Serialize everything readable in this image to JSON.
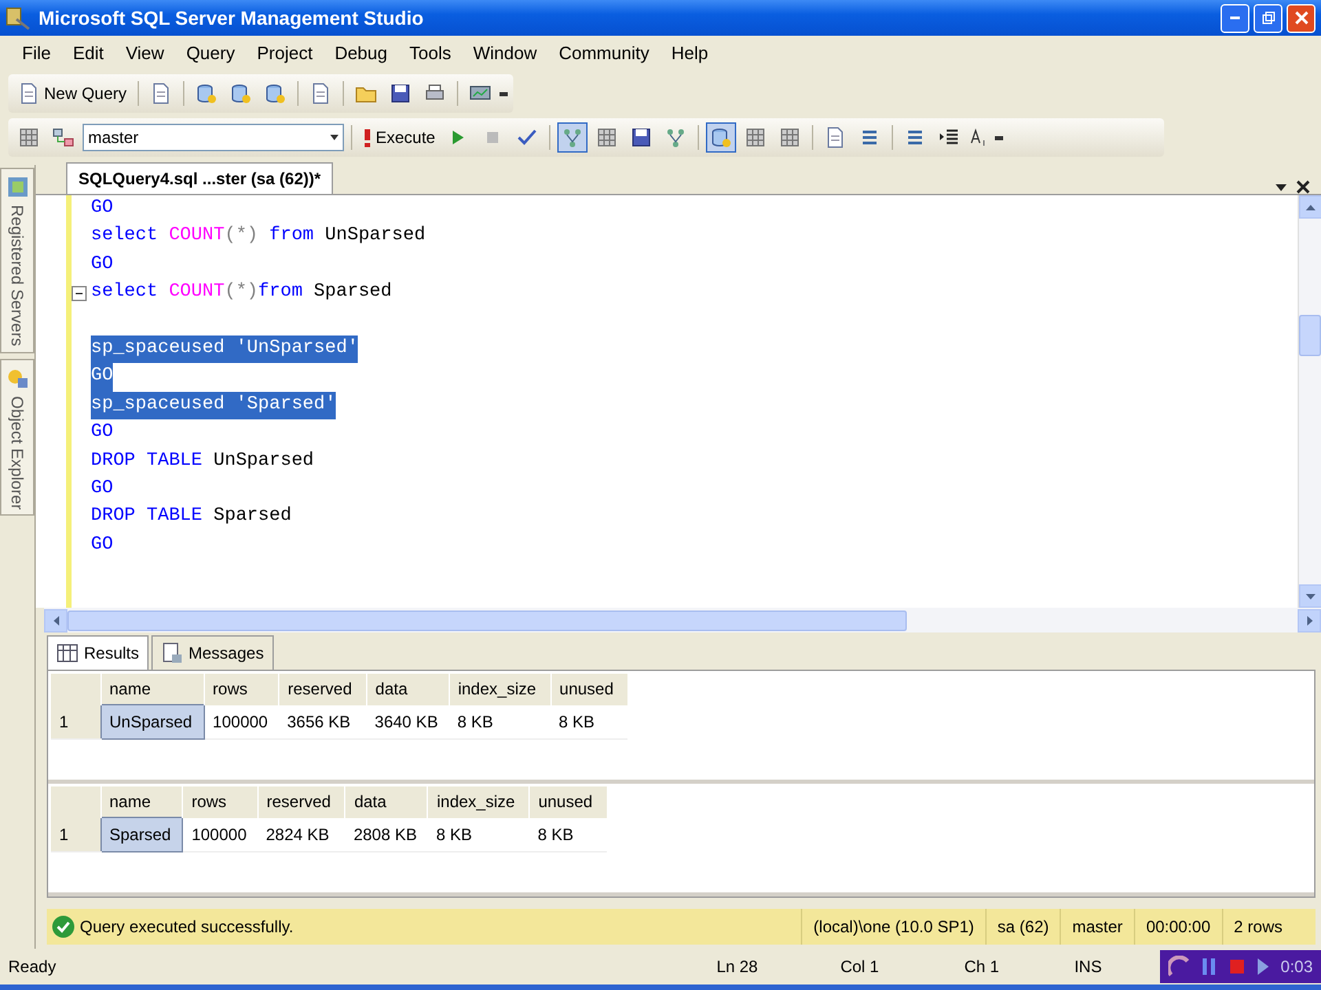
{
  "window": {
    "title": "Microsoft SQL Server Management Studio"
  },
  "menu": [
    "File",
    "Edit",
    "View",
    "Query",
    "Project",
    "Debug",
    "Tools",
    "Window",
    "Community",
    "Help"
  ],
  "toolbar1": {
    "new_query": "New Query",
    "buttons": [
      {
        "pressed": false
      },
      {
        "pressed": false
      },
      {
        "pressed": false
      },
      {
        "pressed": false
      },
      {
        "pressed": false
      },
      {
        "pressed": false
      },
      {
        "pressed": false
      },
      {
        "pressed": false
      },
      {
        "pressed": false
      }
    ]
  },
  "toolbar2": {
    "database": "master",
    "execute": "Execute",
    "buttons": [
      {
        "pressed": false
      },
      {
        "pressed": false
      },
      {
        "pressed": false
      },
      {
        "pressed": false
      },
      {
        "pressed": false
      },
      {
        "pressed": true
      },
      {
        "pressed": false
      },
      {
        "pressed": false
      },
      {
        "pressed": false
      },
      {
        "pressed": true
      },
      {
        "pressed": false
      },
      {
        "pressed": false
      },
      {
        "pressed": false
      },
      {
        "pressed": false
      },
      {
        "pressed": false
      },
      {
        "pressed": false
      }
    ]
  },
  "side_tabs": [
    "Registered Servers",
    "Object Explorer"
  ],
  "document_tab": {
    "title": "SQLQuery4.sql ...ster (sa (62))*"
  },
  "editor": {
    "lines": [
      {
        "kind": "code",
        "highlighted": false,
        "tokens": [
          {
            "text": "GO",
            "kind": "keyword"
          }
        ]
      },
      {
        "kind": "code",
        "highlighted": false,
        "tokens": [
          {
            "text": "select",
            "kind": "keyword"
          },
          {
            "text": " COUNT",
            "kind": "function"
          },
          {
            "text": "(*)",
            "kind": "punct"
          },
          {
            "text": " from",
            "kind": "keyword"
          },
          {
            "text": " UnSparsed",
            "kind": "plain"
          }
        ]
      },
      {
        "kind": "code",
        "highlighted": false,
        "tokens": [
          {
            "text": "GO",
            "kind": "keyword"
          }
        ]
      },
      {
        "kind": "code",
        "highlighted": false,
        "fold": true,
        "tokens": [
          {
            "text": "select",
            "kind": "keyword"
          },
          {
            "text": " COUNT",
            "kind": "function"
          },
          {
            "text": "(*)",
            "kind": "punct"
          },
          {
            "text": "from",
            "kind": "keyword"
          },
          {
            "text": " Sparsed",
            "kind": "plain"
          }
        ]
      },
      {
        "kind": "blank"
      },
      {
        "kind": "code",
        "highlighted": true,
        "tokens": [
          {
            "text": "sp_spaceused",
            "kind": "plain"
          },
          {
            "text": " 'UnSparsed'",
            "kind": "string"
          }
        ]
      },
      {
        "kind": "code",
        "highlighted": true,
        "tokens": [
          {
            "text": "GO",
            "kind": "keyword"
          }
        ]
      },
      {
        "kind": "code",
        "highlighted": true,
        "tokens": [
          {
            "text": "sp_spaceused",
            "kind": "plain"
          },
          {
            "text": " 'Sparsed'",
            "kind": "string"
          }
        ]
      },
      {
        "kind": "code",
        "highlighted": false,
        "tokens": [
          {
            "text": "GO",
            "kind": "keyword"
          }
        ]
      },
      {
        "kind": "code",
        "highlighted": false,
        "tokens": [
          {
            "text": "DROP",
            "kind": "keyword"
          },
          {
            "text": " TABLE",
            "kind": "keyword"
          },
          {
            "text": " UnSparsed",
            "kind": "plain"
          }
        ]
      },
      {
        "kind": "code",
        "highlighted": false,
        "tokens": [
          {
            "text": "GO",
            "kind": "keyword"
          }
        ]
      },
      {
        "kind": "code",
        "highlighted": false,
        "tokens": [
          {
            "text": "DROP",
            "kind": "keyword"
          },
          {
            "text": " TABLE",
            "kind": "keyword"
          },
          {
            "text": " Sparsed",
            "kind": "plain"
          }
        ]
      },
      {
        "kind": "code",
        "highlighted": false,
        "tokens": [
          {
            "text": "GO",
            "kind": "keyword"
          }
        ]
      }
    ]
  },
  "result_tabs": [
    {
      "label": "Results",
      "selected": true
    },
    {
      "label": "Messages",
      "selected": false
    }
  ],
  "result_sets": [
    {
      "columns": [
        "name",
        "rows",
        "reserved",
        "data",
        "index_size",
        "unused"
      ],
      "rows": [
        {
          "number": "1",
          "cells": [
            "UnSparsed",
            "100000",
            "3656 KB",
            "3640 KB",
            "8 KB",
            "8 KB"
          ]
        }
      ]
    },
    {
      "columns": [
        "name",
        "rows",
        "reserved",
        "data",
        "index_size",
        "unused"
      ],
      "rows": [
        {
          "number": "1",
          "cells": [
            "Sparsed",
            "100000",
            "2824 KB",
            "2808 KB",
            "8 KB",
            "8 KB"
          ]
        }
      ]
    }
  ],
  "query_status": {
    "message": "Query executed successfully.",
    "server": "(local)\\one (10.0 SP1)",
    "user": "sa (62)",
    "database": "master",
    "elapsed": "00:00:00",
    "rows": "2 rows"
  },
  "status_bar": {
    "state": "Ready",
    "line": "Ln 28",
    "column": "Col 1",
    "char": "Ch 1",
    "mode": "INS"
  },
  "recorder": {
    "time": "0:03"
  }
}
